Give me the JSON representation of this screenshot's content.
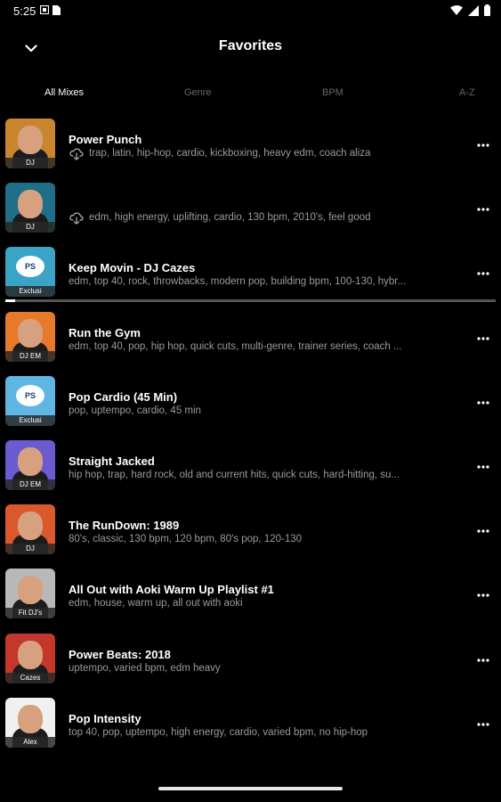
{
  "status_bar": {
    "time": "5:25",
    "icons_left": [
      "notification-icon",
      "sim-icon"
    ],
    "icons_right": [
      "wifi-icon",
      "signal-icon",
      "battery-icon"
    ]
  },
  "header": {
    "title": "Favorites",
    "back_icon": "chevron-down-icon"
  },
  "tabs": [
    {
      "label": "All Mixes",
      "active": true
    },
    {
      "label": "Genre",
      "active": false
    },
    {
      "label": "BPM",
      "active": false
    },
    {
      "label": "A-Z",
      "active": false
    }
  ],
  "items": [
    {
      "title": "Power Punch",
      "tags": "trap, latin, hip-hop, cardio, kickboxing, heavy edm, coach aliza",
      "badge": "DJ",
      "cloud": true,
      "thumb_color": "#c9862e"
    },
    {
      "title": "",
      "tags": "edm, high energy, uplifting, cardio, 130 bpm, 2010's, feel good",
      "badge": "DJ",
      "cloud": true,
      "thumb_color": "#1f6f88"
    },
    {
      "title": "Keep Movin - DJ Cazes",
      "tags": "edm, top 40, rock, throwbacks, modern pop, building bpm, 100-130, hybr...",
      "badge": "Exclusi",
      "cloud": false,
      "thumb_color": "#3aa3c6",
      "logo": "PS",
      "progress": 0.02
    },
    {
      "title": "Run the Gym",
      "tags": "edm, top 40, pop, hip hop, quick cuts, multi-genre, trainer series, coach ...",
      "badge": "DJ EM",
      "cloud": false,
      "thumb_color": "#e7792a"
    },
    {
      "title": "Pop Cardio (45 Min)",
      "tags": "pop, uptempo, cardio, 45 min",
      "badge": "Exclusi",
      "cloud": false,
      "thumb_color": "#5fb6e3",
      "logo": "PS"
    },
    {
      "title": "Straight Jacked",
      "tags": "hip hop, trap, hard rock, old and current hits, quick cuts, hard-hitting, su...",
      "badge": "DJ EM",
      "cloud": false,
      "thumb_color": "#6a5bd1"
    },
    {
      "title": "The RunDown: 1989",
      "tags": "80's, classic, 130 bpm, 120 bpm, 80's pop, 120-130",
      "badge": "DJ",
      "cloud": false,
      "thumb_color": "#d9582c"
    },
    {
      "title": "All Out with Aoki Warm Up Playlist #1",
      "tags": "edm, house, warm up, all out with aoki",
      "badge": "Fit DJ's",
      "cloud": false,
      "thumb_color": "#b8b8b8"
    },
    {
      "title": "Power Beats: 2018",
      "tags": "uptempo, varied bpm, edm heavy",
      "badge": "Cazes",
      "cloud": false,
      "thumb_color": "#c4372b"
    },
    {
      "title": "Pop Intensity",
      "tags": "top 40, pop, uptempo, high energy, cardio, varied bpm, no hip-hop",
      "badge": "Alex",
      "cloud": false,
      "thumb_color": "#f0f0f0"
    }
  ],
  "more_icon": "more-vert-icon"
}
